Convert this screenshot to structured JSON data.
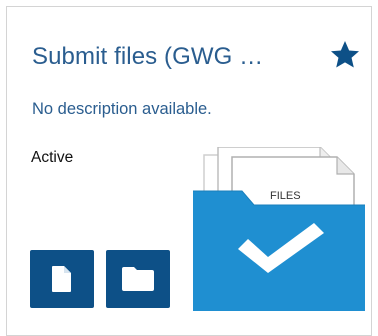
{
  "card": {
    "title": "Submit files (GWG …",
    "description": "No description available.",
    "status": "Active",
    "favorite_icon": "star-icon",
    "illustration": {
      "label": "FILES",
      "icon": "checkmark-icon",
      "accent": "#1f8fd1"
    },
    "actions": [
      {
        "icon": "file-icon"
      },
      {
        "icon": "folder-icon"
      }
    ]
  },
  "colors": {
    "title": "#2a5d8f",
    "button_bg": "#0d5087",
    "border": "#d4d4d4"
  }
}
